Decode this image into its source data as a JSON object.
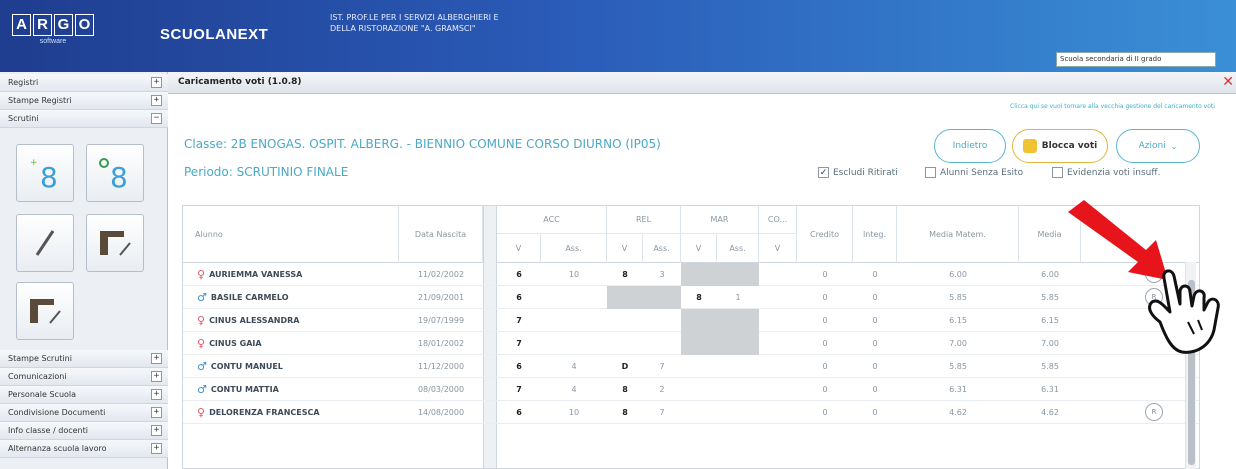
{
  "header": {
    "logo_letters": [
      "A",
      "R",
      "G",
      "O"
    ],
    "logo_sub": "software",
    "product": "SCUOLANEXT",
    "school": "IST. PROF.LE PER I SERVIZI ALBERGHIERI E\nDELLA RISTORAZIONE \"A. GRAMSCI\"",
    "school_select": "Scuola secondaria di II grado"
  },
  "sidebar": {
    "top_items": [
      "Registri",
      "Stampe Registri",
      "Scrutini"
    ],
    "bottom_items": [
      "Stampe Scrutini",
      "Comunicazioni",
      "Personale Scuola",
      "Condivisione Documenti",
      "Info classe / docenti",
      "Alternanza scuola lavoro"
    ],
    "toggle_plus": "+",
    "toggle_minus": "−",
    "tile_digit": "8"
  },
  "panel": {
    "title": "Caricamento voti (1.0.8)",
    "close": "✕",
    "note": "Clicca qui se vuoi tornare alla vecchia gestione del caricamento voti",
    "classe": "Classe: 2B ENOGAS. OSPIT. ALBERG. - BIENNIO COMUNE CORSO DIURNO (IP05)",
    "periodo": "Periodo: SCRUTINIO FINALE",
    "buttons": {
      "indietro": "Indietro",
      "blocca": "Blocca voti",
      "azioni": "Azioni"
    },
    "checks": [
      {
        "label": "Escludi Ritirati",
        "checked": "✓"
      },
      {
        "label": "Alunni Senza Esito",
        "checked": ""
      },
      {
        "label": "Evidenzia voti insuff.",
        "checked": ""
      }
    ]
  },
  "grid": {
    "headers": {
      "alunno": "Alunno",
      "data_nascita": "Data Nascita",
      "subjects": [
        "ACC",
        "REL",
        "MAR",
        "CO..."
      ],
      "v": "V",
      "ass": "Ass.",
      "credito": "Credito",
      "integ": "Integ.",
      "media_matem": "Media Matem.",
      "media": "Media"
    },
    "rows": [
      {
        "gender": "f",
        "name": "AURIEMMA VANESSA",
        "dob": "11/02/2002",
        "acc_v": "6",
        "acc_a": "10",
        "rel_v": "8",
        "rel_a": "3",
        "mar_v": "",
        "mar_a": "",
        "co_v": "",
        "credito": "0",
        "integ": "0",
        "mm": "6.00",
        "media": "6.00"
      },
      {
        "gender": "m",
        "name": "BASILE CARMELO",
        "dob": "21/09/2001",
        "acc_v": "6",
        "acc_a": "",
        "rel_v": "",
        "rel_a": "",
        "mar_v": "8",
        "mar_a": "1",
        "co_v": "",
        "credito": "0",
        "integ": "0",
        "mm": "5.85",
        "media": "5.85"
      },
      {
        "gender": "f",
        "name": "CINUS ALESSANDRA",
        "dob": "19/07/1999",
        "acc_v": "7",
        "acc_a": "",
        "rel_v": "",
        "rel_a": "",
        "mar_v": "",
        "mar_a": "",
        "co_v": "",
        "credito": "0",
        "integ": "0",
        "mm": "6.15",
        "media": "6.15"
      },
      {
        "gender": "f",
        "name": "CINUS GAIA",
        "dob": "18/01/2002",
        "acc_v": "7",
        "acc_a": "",
        "rel_v": "",
        "rel_a": "",
        "mar_v": "",
        "mar_a": "",
        "co_v": "",
        "credito": "0",
        "integ": "0",
        "mm": "7.00",
        "media": "7.00"
      },
      {
        "gender": "m",
        "name": "CONTU MANUEL",
        "dob": "11/12/2000",
        "acc_v": "6",
        "acc_a": "4",
        "rel_v": "D",
        "rel_a": "7",
        "mar_v": "",
        "mar_a": "",
        "co_v": "",
        "credito": "0",
        "integ": "0",
        "mm": "5.85",
        "media": "5.85"
      },
      {
        "gender": "m",
        "name": "CONTU MATTIA",
        "dob": "08/03/2000",
        "acc_v": "7",
        "acc_a": "4",
        "rel_v": "8",
        "rel_a": "2",
        "mar_v": "",
        "mar_a": "",
        "co_v": "",
        "credito": "0",
        "integ": "0",
        "mm": "6.31",
        "media": "6.31"
      },
      {
        "gender": "f",
        "name": "DELORENZA FRANCESCA",
        "dob": "14/08/2000",
        "acc_v": "6",
        "acc_a": "10",
        "rel_v": "8",
        "rel_a": "7",
        "mar_v": "",
        "mar_a": "",
        "co_v": "",
        "credito": "0",
        "integ": "0",
        "mm": "4.62",
        "media": "4.62"
      }
    ],
    "row_button": "R",
    "gender_f": "♀",
    "gender_m": "♂"
  },
  "colors": {
    "accent": "#4aa9c4",
    "arrow": "#e8141c",
    "header": "#2a5bb8"
  },
  "icons": [
    "pointing-hand-icon",
    "red-arrow-icon",
    "lock-icon",
    "close-icon"
  ]
}
